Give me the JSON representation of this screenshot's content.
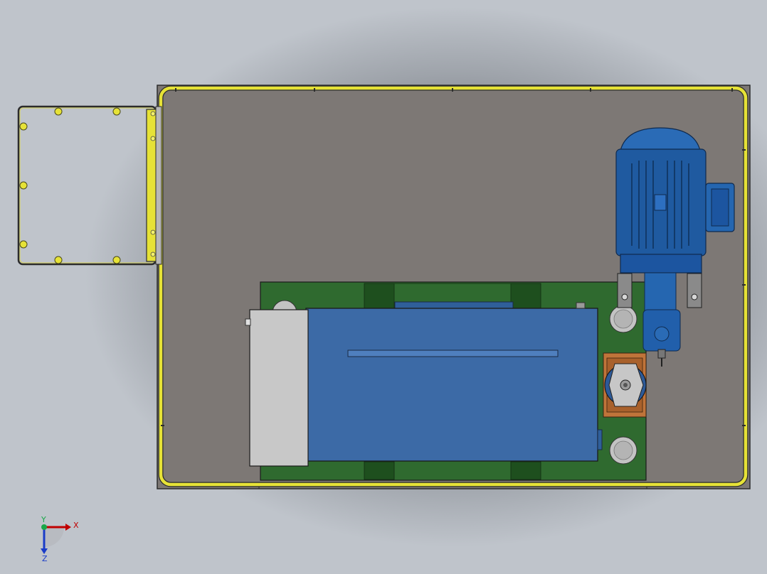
{
  "viewport": {
    "view": "top",
    "background_top": "#55595e",
    "background_bottom": "#c7ccd3"
  },
  "model": {
    "base_plate_color": "#7d7875",
    "guard_rail_color": "#e6e237",
    "skid_color": "#2f6a2f",
    "tank_color": "#3c6aa6",
    "end_cap_color": "#c8c8c8",
    "motor_color": "#1f5aa0",
    "coupling_flange_color": "#c0743a"
  },
  "triad": {
    "x_label": "X",
    "y_label": "Y",
    "z_label": "Z",
    "x_color": "#c00000",
    "y_color": "#1aa84a",
    "z_color": "#1a3cc8"
  }
}
